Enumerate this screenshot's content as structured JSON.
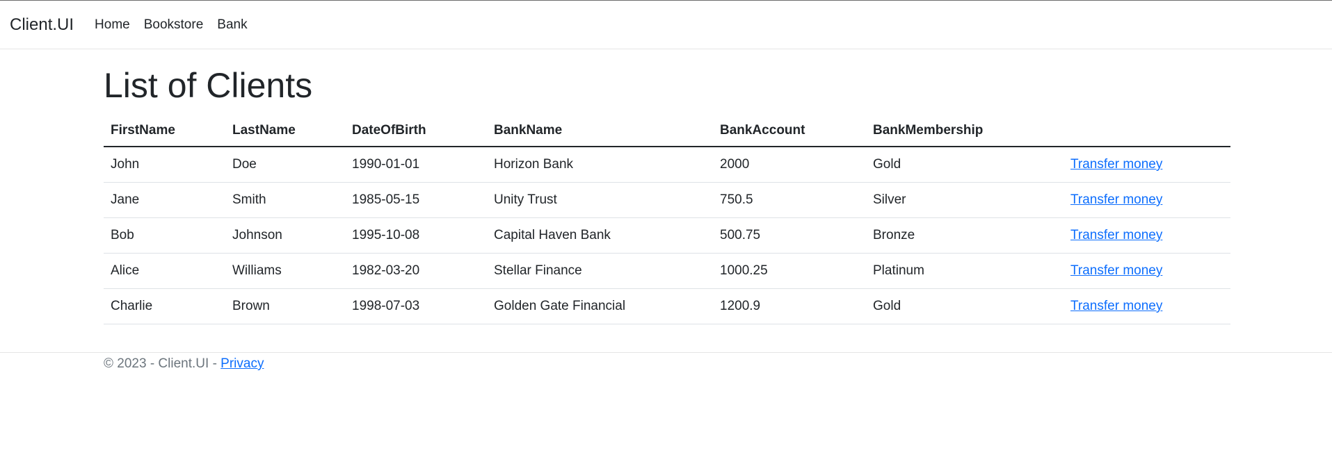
{
  "nav": {
    "brand": "Client.UI",
    "items": [
      {
        "label": "Home"
      },
      {
        "label": "Bookstore"
      },
      {
        "label": "Bank"
      }
    ]
  },
  "page": {
    "title": "List of Clients"
  },
  "table": {
    "headers": [
      "FirstName",
      "LastName",
      "DateOfBirth",
      "BankName",
      "BankAccount",
      "BankMembership",
      ""
    ],
    "rows": [
      {
        "first": "John",
        "last": "Doe",
        "dob": "1990-01-01",
        "bank": "Horizon Bank",
        "account": "2000",
        "membership": "Gold",
        "action": "Transfer money"
      },
      {
        "first": "Jane",
        "last": "Smith",
        "dob": "1985-05-15",
        "bank": "Unity Trust",
        "account": "750.5",
        "membership": "Silver",
        "action": "Transfer money"
      },
      {
        "first": "Bob",
        "last": "Johnson",
        "dob": "1995-10-08",
        "bank": "Capital Haven Bank",
        "account": "500.75",
        "membership": "Bronze",
        "action": "Transfer money"
      },
      {
        "first": "Alice",
        "last": "Williams",
        "dob": "1982-03-20",
        "bank": "Stellar Finance",
        "account": "1000.25",
        "membership": "Platinum",
        "action": "Transfer money"
      },
      {
        "first": "Charlie",
        "last": "Brown",
        "dob": "1998-07-03",
        "bank": "Golden Gate Financial",
        "account": "1200.9",
        "membership": "Gold",
        "action": "Transfer money"
      }
    ]
  },
  "footer": {
    "copyright": "© 2023 - Client.UI - ",
    "privacy_label": "Privacy"
  }
}
